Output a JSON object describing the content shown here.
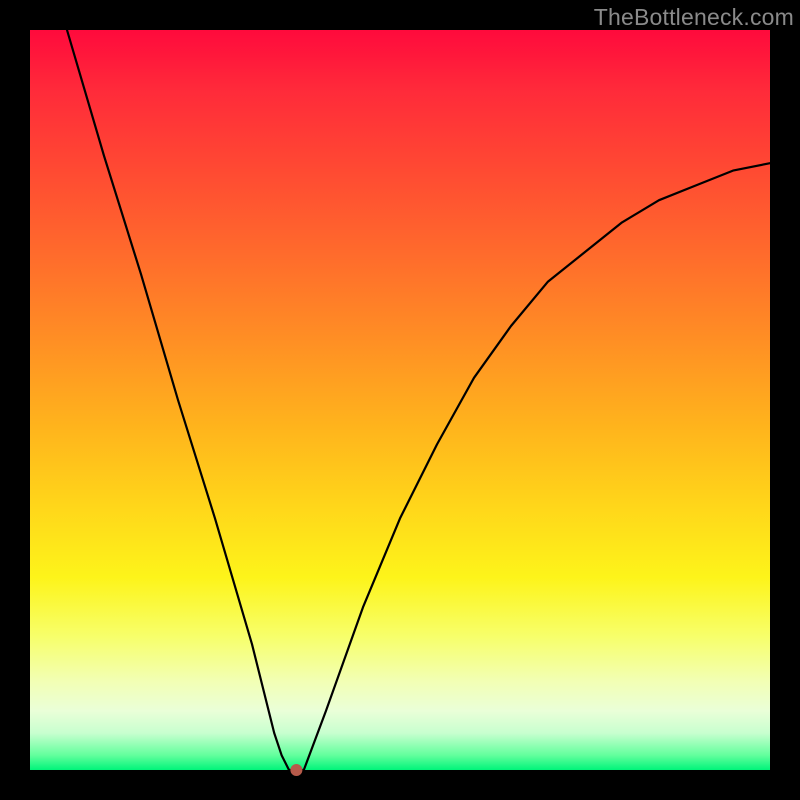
{
  "watermark": "TheBottleneck.com",
  "chart_data": {
    "type": "line",
    "title": "",
    "xlabel": "",
    "ylabel": "",
    "xlim": [
      0,
      100
    ],
    "ylim": [
      0,
      100
    ],
    "x": [
      5,
      10,
      15,
      20,
      25,
      30,
      33,
      34,
      35,
      36,
      37,
      40,
      45,
      50,
      55,
      60,
      65,
      70,
      75,
      80,
      85,
      90,
      95,
      100
    ],
    "values": [
      100,
      83,
      67,
      50,
      34,
      17,
      5,
      2,
      0,
      0,
      0,
      8,
      22,
      34,
      44,
      53,
      60,
      66,
      70,
      74,
      77,
      79,
      81,
      82
    ],
    "min_point": {
      "x": 36,
      "y": 0
    },
    "background_gradient": {
      "top": "#ff0a3c",
      "mid": "#ffd51a",
      "bottom": "#00f47a"
    }
  }
}
